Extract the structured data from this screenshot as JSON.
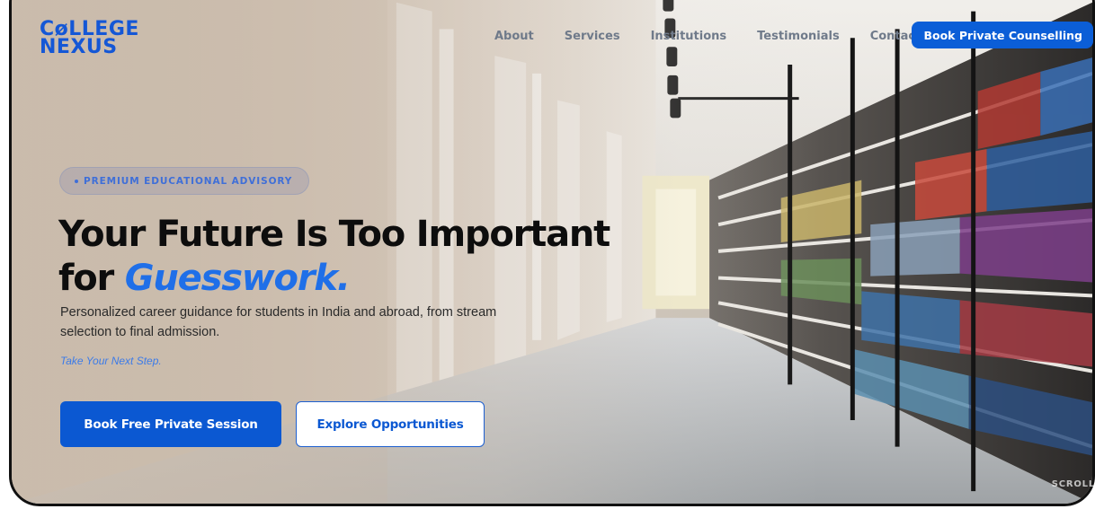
{
  "brand": {
    "line1": "CøLLEGE",
    "line2": "NEXUS"
  },
  "nav": {
    "items": [
      {
        "label": "About"
      },
      {
        "label": "Services"
      },
      {
        "label": "Institutions"
      },
      {
        "label": "Testimonials"
      },
      {
        "label": "Contact"
      }
    ],
    "cta_label": "Book Private Counselling"
  },
  "hero": {
    "badge": "PREMIUM EDUCATIONAL ADVISORY",
    "headline_line1": "Your Future Is Too Important",
    "headline_line2_prefix": "for ",
    "headline_line2_accent": "Guesswork.",
    "subtext": "Personalized career guidance for students in India and abroad, from stream selection to final admission.",
    "tagline": "Take Your Next Step.",
    "primary_button": "Book Free Private Session",
    "secondary_button": "Explore Opportunities",
    "scroll_hint": "SCROLL"
  },
  "colors": {
    "accent": "#0b58d2",
    "headline_accent": "#1f6fe8",
    "badge_text": "#3f6fd8",
    "nav_text": "#6f7a8a"
  },
  "icons": {
    "badge_bullet": "dot-icon"
  }
}
